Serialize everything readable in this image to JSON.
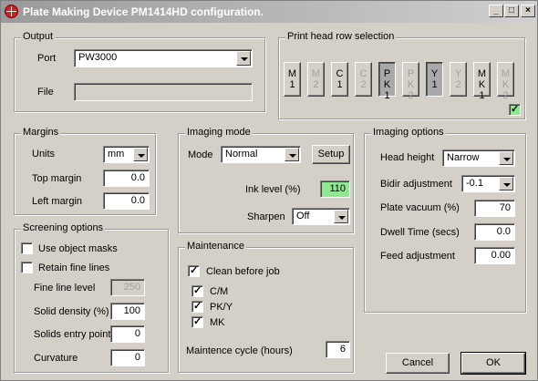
{
  "window": {
    "title": "Plate Making Device PM1414HD configuration."
  },
  "output": {
    "legend": "Output",
    "port_label": "Port",
    "port_value": "PW3000",
    "file_label": "File",
    "file_value": ""
  },
  "printhead": {
    "legend": "Print head row selection",
    "buttons": [
      {
        "l1": "M",
        "l2": "1",
        "state": "enabled"
      },
      {
        "l1": "M",
        "l2": "2",
        "state": "disabled"
      },
      {
        "l1": "C",
        "l2": "1",
        "state": "enabled"
      },
      {
        "l1": "C",
        "l2": "2",
        "state": "disabled"
      },
      {
        "l1": "PK",
        "l2": "1",
        "state": "pressed"
      },
      {
        "l1": "PK",
        "l2": "2",
        "state": "disabled"
      },
      {
        "l1": "Y",
        "l2": "1",
        "state": "pressed"
      },
      {
        "l1": "Y",
        "l2": "2",
        "state": "disabled"
      },
      {
        "l1": "MK",
        "l2": "1",
        "state": "enabled"
      },
      {
        "l1": "MK",
        "l2": "2",
        "state": "disabled"
      }
    ],
    "checkbox_checked": true
  },
  "margins": {
    "legend": "Margins",
    "units_label": "Units",
    "units_value": "mm",
    "top_label": "Top margin",
    "top_value": "0.0",
    "left_label": "Left margin",
    "left_value": "0.0"
  },
  "screening": {
    "legend": "Screening options",
    "use_object_masks_label": "Use object masks",
    "use_object_masks_checked": false,
    "retain_fine_lines_label": "Retain fine lines",
    "retain_fine_lines_checked": false,
    "fine_line_level_label": "Fine line level",
    "fine_line_level_value": "250",
    "solid_density_label": "Solid density (%)",
    "solid_density_value": "100",
    "solids_entry_label": "Solids entry point",
    "solids_entry_value": "0",
    "curvature_label": "Curvature",
    "curvature_value": "0"
  },
  "imaging_mode": {
    "legend": "Imaging mode",
    "mode_label": "Mode",
    "mode_value": "Normal",
    "setup_label": "Setup",
    "ink_level_label": "Ink level (%)",
    "ink_level_value": "110",
    "sharpen_label": "Sharpen",
    "sharpen_value": "Off"
  },
  "imaging_options": {
    "legend": "Imaging options",
    "head_height_label": "Head height",
    "head_height_value": "Narrow",
    "bidir_label": "Bidir adjustment",
    "bidir_value": "-0.1",
    "plate_vacuum_label": "Plate vacuum (%)",
    "plate_vacuum_value": "70",
    "dwell_label": "Dwell Time (secs)",
    "dwell_value": "0.0",
    "feed_label": "Feed adjustment",
    "feed_value": "0.00"
  },
  "maintenance": {
    "legend": "Maintenance",
    "clean_label": "Clean before job",
    "clean_checked": true,
    "cm_label": "C/M",
    "cm_checked": true,
    "pky_label": "PK/Y",
    "pky_checked": true,
    "mk_label": "MK",
    "mk_checked": true,
    "cycle_label": "Maintence cycle (hours)",
    "cycle_value": "6"
  },
  "footer": {
    "cancel_label": "Cancel",
    "ok_label": "OK"
  },
  "titlebar_buttons": {
    "minimize": "_",
    "maximize": "□",
    "close": "×"
  }
}
